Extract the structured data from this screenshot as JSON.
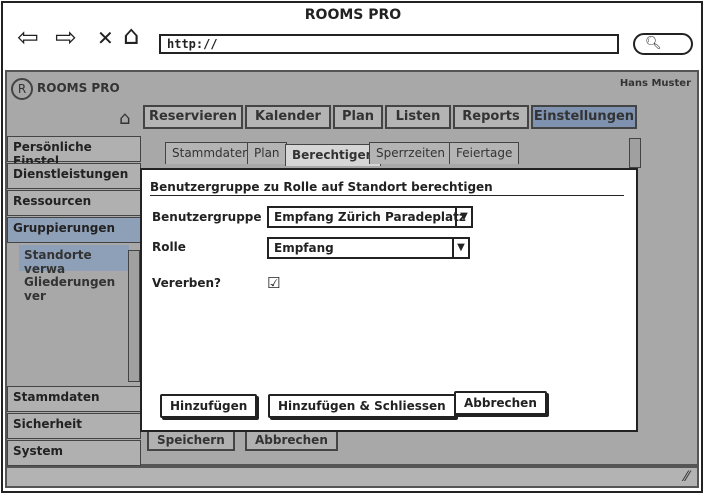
{
  "browser": {
    "title": "ROOMS PRO",
    "url": "http://",
    "icons": {
      "back": "arrow-left-icon",
      "forward": "arrow-right-icon",
      "stop": "close-icon",
      "home": "home-icon",
      "search": "search-icon"
    }
  },
  "app": {
    "name": "ROOMS PRO",
    "logo_letter": "R",
    "user": "Hans Muster",
    "nav_tabs": [
      {
        "label": "Reservieren"
      },
      {
        "label": "Kalender"
      },
      {
        "label": "Plan"
      },
      {
        "label": "Listen"
      },
      {
        "label": "Reports"
      },
      {
        "label": "Einstellungen",
        "active": true
      }
    ],
    "sidebar": {
      "items": [
        {
          "label": "Persönliche Einstel"
        },
        {
          "label": "Dienstleistungen"
        },
        {
          "label": "Ressourcen"
        },
        {
          "label": "Gruppierungen",
          "selected": true
        }
      ],
      "sub_items": [
        {
          "label": "Standorte verwa",
          "selected": true
        },
        {
          "label": "Gliederungen ver"
        }
      ],
      "bottom_items": [
        {
          "label": "Stammdaten"
        },
        {
          "label": "Sicherheit"
        },
        {
          "label": "System"
        }
      ]
    },
    "sub_tabs": [
      {
        "label": "Stammdaten"
      },
      {
        "label": "Plan"
      },
      {
        "label": "Berechtigen",
        "active": true
      },
      {
        "label": "Sperrzeiten"
      },
      {
        "label": "Feiertage"
      }
    ],
    "buttons": {
      "save": "Speichern",
      "cancel": "Abbrechen"
    }
  },
  "modal": {
    "title": "Benutzergruppe zu Rolle auf Standort berechtigen",
    "fields": {
      "group_label": "Benutzergruppe",
      "group_value": "Empfang Zürich Paradeplatz",
      "role_label": "Rolle",
      "role_value": "Empfang",
      "inherit_label": "Vererben?",
      "inherit_checked": true
    },
    "buttons": {
      "add": "Hinzufügen",
      "add_close": "Hinzufügen & Schliessen",
      "cancel": "Abbrechen"
    }
  }
}
